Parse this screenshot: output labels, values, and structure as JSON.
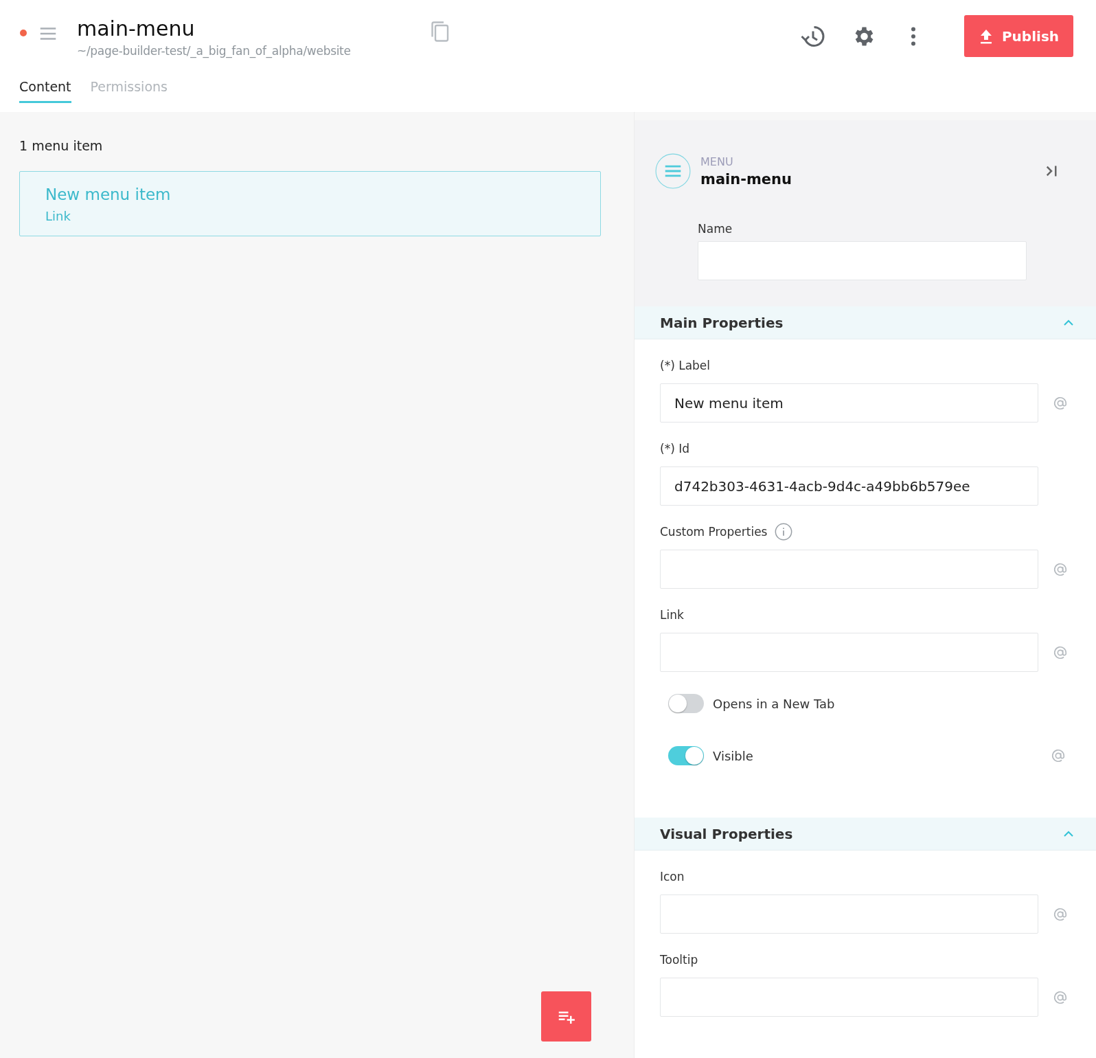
{
  "header": {
    "unsaved": true,
    "title": "main-menu",
    "path": "~/page-builder-test/_a_big_fan_of_alpha/website",
    "publish_label": "Publish"
  },
  "tabs": [
    {
      "label": "Content",
      "selected": true
    },
    {
      "label": "Permissions",
      "selected": false
    }
  ],
  "content": {
    "count": "1 menu item",
    "items": [
      {
        "label": "New menu item",
        "type": "Link",
        "selected": true
      }
    ]
  },
  "panel": {
    "kind_label": "MENU",
    "name": "main-menu",
    "name_field": {
      "label": "Name"
    },
    "sections": [
      {
        "title": "Main Properties",
        "expanded": true,
        "fields": [
          {
            "kind": "text",
            "label": "(*) Label",
            "value": "New menu item",
            "info": false,
            "expression": true
          },
          {
            "kind": "text",
            "label": "(*) Id",
            "value": "d742b303-4631-4acb-9d4c-a49bb6b579ee",
            "info": false,
            "expression": false
          },
          {
            "kind": "text",
            "label": "Custom Properties",
            "info": true,
            "expression": true
          },
          {
            "kind": "text",
            "label": "Link",
            "info": false,
            "expression": true
          },
          {
            "kind": "toggle",
            "label": "Opens in a New Tab",
            "on": false,
            "expression": false
          },
          {
            "kind": "toggle",
            "label": "Visible",
            "on": true,
            "expression": true
          }
        ]
      },
      {
        "title": "Visual Properties",
        "expanded": true,
        "fields": [
          {
            "kind": "text",
            "label": "Icon",
            "info": false,
            "expression": true
          },
          {
            "kind": "text",
            "label": "Tooltip",
            "info": false,
            "expression": true
          }
        ]
      }
    ]
  }
}
